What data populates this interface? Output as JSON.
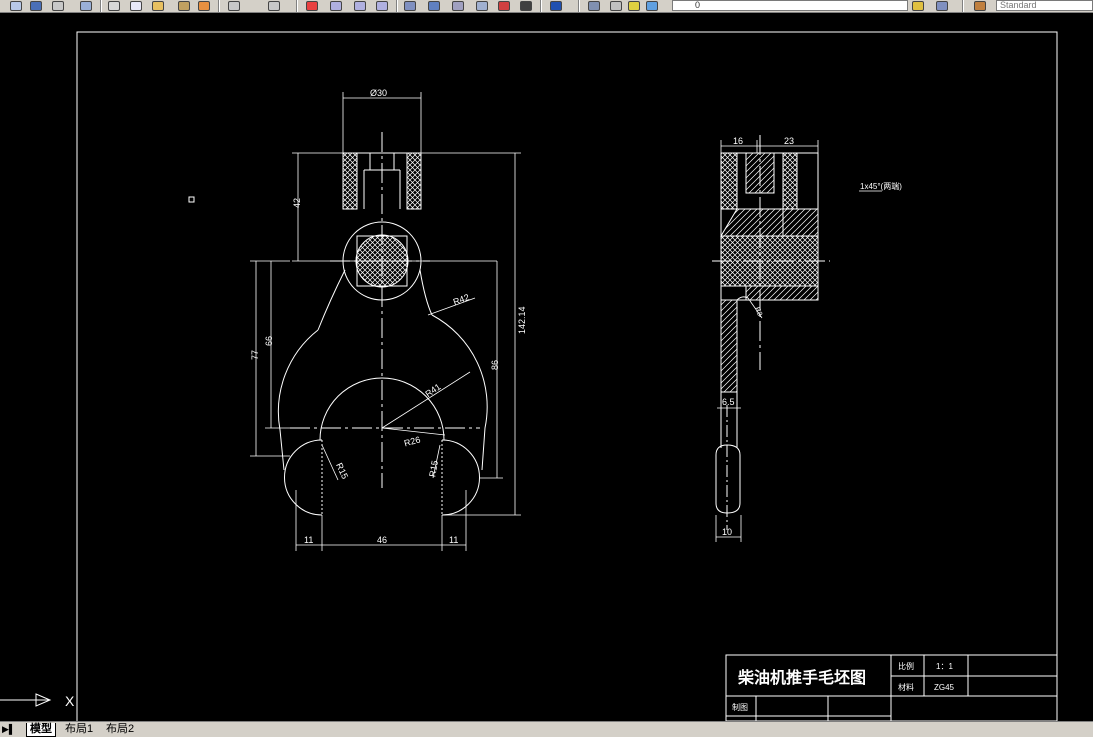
{
  "toolbar": {
    "style_value": "Standard",
    "layer_value": "0"
  },
  "drawing": {
    "front_view": {
      "dims": {
        "top_dia": "Ø30",
        "h42": "42",
        "h77": "77",
        "h66": "66",
        "h142": "142.14",
        "h86": "86",
        "r42": "R42",
        "r41": "R41",
        "r26": "R26",
        "r15_left": "R15",
        "r15_right": "R15",
        "w11_left": "11",
        "w46": "46",
        "w11_right": "11"
      }
    },
    "side_view": {
      "dims": {
        "w16": "16",
        "w23": "23",
        "chamfer_note": "1x45°(两端)",
        "r8": "R8",
        "t65": "6.5",
        "w10": "10"
      }
    },
    "title_block": {
      "title": "柴油机推手毛坯图",
      "scale_label": "比例",
      "scale_value": "1：1",
      "material_label": "材料",
      "material_value": "ZG45",
      "drawn_label": "制图"
    },
    "ucs": {
      "x_label": "X"
    }
  },
  "tabs": {
    "model": "模型",
    "layout1": "布局1",
    "layout2": "布局2"
  },
  "colors": {
    "background": "#000000",
    "lines": "#ffffff",
    "toolbar": "#d4d0c8"
  }
}
